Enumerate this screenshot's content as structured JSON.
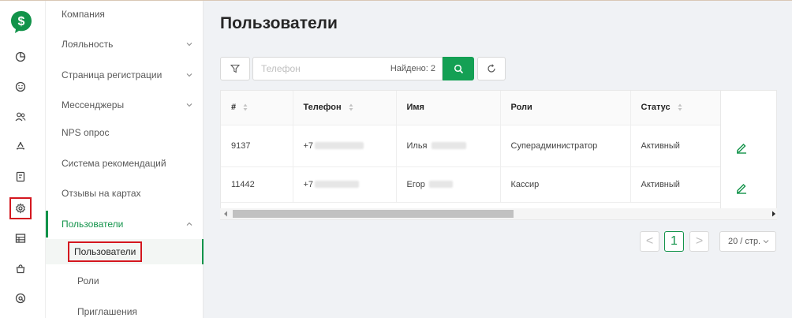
{
  "colors": {
    "brand": "#12934a",
    "highlight": "#d4171f"
  },
  "logo": {
    "glyph": "$"
  },
  "rail": {
    "icons": [
      "chart-pie-icon",
      "smile-icon",
      "users-icon",
      "recycle-icon",
      "receipt-icon",
      "gear-icon",
      "table-icon",
      "bag-icon",
      "at-icon"
    ],
    "active": "gear-icon"
  },
  "menu": {
    "items": [
      {
        "label": "Компания"
      },
      {
        "label": "Лояльность"
      },
      {
        "label": "Страница регистрации"
      },
      {
        "label": "Мессенджеры"
      },
      {
        "label": "NPS опрос"
      },
      {
        "label": "Система рекомендаций"
      },
      {
        "label": "Отзывы на картах"
      },
      {
        "label": "Пользователи"
      }
    ],
    "sub_items": [
      {
        "label": "Пользователи"
      },
      {
        "label": "Роли"
      },
      {
        "label": "Приглашения"
      }
    ]
  },
  "page": {
    "title": "Пользователи"
  },
  "search": {
    "placeholder": "Телефон",
    "found": "Найдено: 2"
  },
  "table": {
    "columns": [
      "#",
      "Телефон",
      "Имя",
      "Роли",
      "Статус"
    ],
    "rows": [
      {
        "id": "9137",
        "phone": "+7",
        "name": "Илья",
        "role": "Суперадминистратор",
        "status": "Активный"
      },
      {
        "id": "11442",
        "phone": "+7",
        "name": "Егор",
        "role": "Кассир",
        "status": "Активный"
      }
    ]
  },
  "pagination": {
    "prev": "<",
    "current": "1",
    "next": ">",
    "page_size": "20 / стр."
  }
}
